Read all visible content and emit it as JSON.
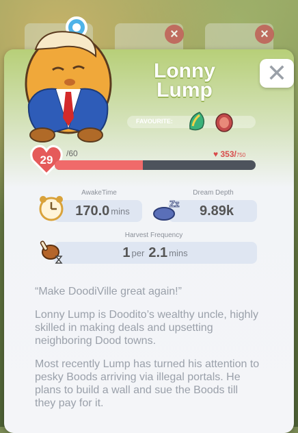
{
  "character": {
    "name_line1": "Lonny",
    "name_line2": "Lump",
    "favourite_label": "FAVOURITE:",
    "favourite_items": [
      "shell-fruit-icon",
      "meat-icon"
    ]
  },
  "level": {
    "level": "29",
    "max_level_text": "/60",
    "hp_current": "353",
    "hp_max": "750",
    "hp_separator": "/",
    "progress": 0.44
  },
  "stats": {
    "awake_label": "AwakeTime",
    "awake_value": "170.0",
    "awake_unit": "mins",
    "dream_label": "Dream Depth",
    "dream_value": "9.89k",
    "harvest_label": "Harvest Frequency",
    "harvest_count": "1",
    "harvest_per": "per",
    "harvest_value": "2.1",
    "harvest_unit": "mins"
  },
  "description": {
    "quote": "“Make DoodiVille great again!”",
    "p1": "Lonny Lump is Doodito’s wealthy uncle, highly skilled in making deals and upsetting neighboring Dood towns.",
    "p2": "Most recently Lump has turned his attention to pesky Boods arriving via illegal portals. He plans to build a wall and sue the Boods till they pay for it."
  },
  "colors": {
    "accent": "#f06a6a",
    "bar_bg": "#4d535c",
    "stat_bg": "#dfe6f2"
  }
}
